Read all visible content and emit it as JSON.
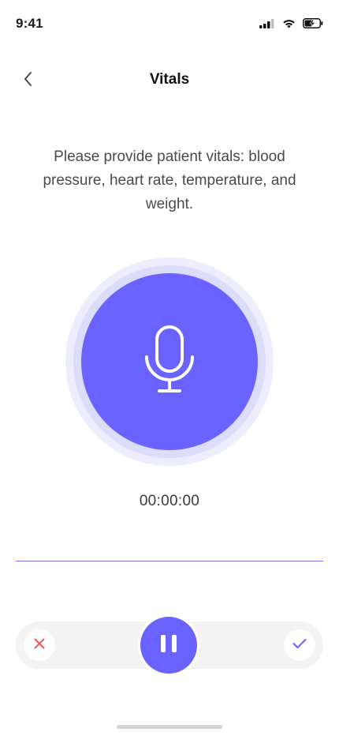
{
  "status_bar": {
    "time": "9:41",
    "icons": [
      "cellular-signal-icon",
      "wifi-icon",
      "battery-charging-icon"
    ]
  },
  "header": {
    "title": "Vitals",
    "back_icon": "chevron-left-icon"
  },
  "prompt": {
    "text": "Please provide patient vitals: blood pressure, heart rate, temperature, and weight."
  },
  "recorder": {
    "mic_icon": "microphone-icon",
    "timer": "00:00:00"
  },
  "controls": {
    "cancel_icon": "close-icon",
    "pause_icon": "pause-icon",
    "confirm_icon": "checkmark-icon"
  },
  "colors": {
    "accent": "#6A63FF",
    "ring_outer": "#EDEDFD",
    "ring_inner": "#DCDCFB",
    "cancel": "#F0595E",
    "control_bar_bg": "#F3F3F3"
  }
}
